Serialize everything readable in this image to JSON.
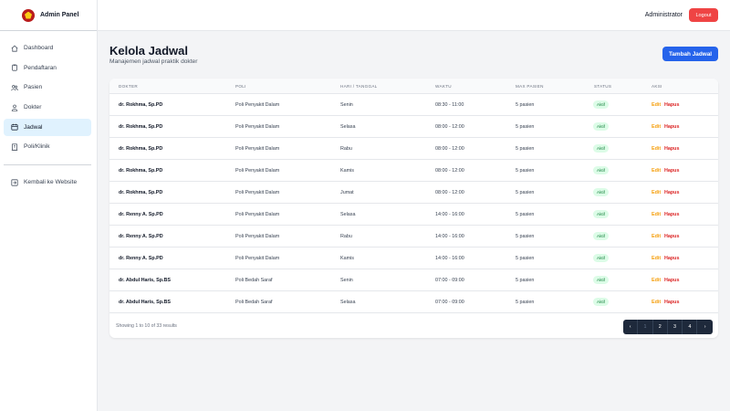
{
  "brand": {
    "title": "Admin Panel"
  },
  "sidebar": {
    "items": [
      {
        "label": "Dashboard",
        "icon": "home-icon"
      },
      {
        "label": "Pendaftaran",
        "icon": "clipboard-icon"
      },
      {
        "label": "Pasien",
        "icon": "users-icon"
      },
      {
        "label": "Dokter",
        "icon": "doctor-icon"
      },
      {
        "label": "Jadwal",
        "icon": "calendar-icon",
        "active": true
      },
      {
        "label": "Poli/Klinik",
        "icon": "building-icon"
      }
    ],
    "back_label": "Kembali ke Website"
  },
  "topbar": {
    "user": "Administrator",
    "logout": "Logout"
  },
  "header": {
    "title": "Kelola Jadwal",
    "subtitle": "Manajemen jadwal praktik dokter",
    "add_button": "Tambah Jadwal"
  },
  "table": {
    "columns": [
      "Dokter",
      "Poli",
      "Hari / Tanggal",
      "Waktu",
      "Max Pasien",
      "Status",
      "Aksi"
    ],
    "rows": [
      {
        "dokter": "dr. Rokhma, Sp.PD",
        "poli": "Poli Penyakit Dalam",
        "hari": "Senin",
        "waktu": "08:30 - 11:00",
        "max": "5 pasien",
        "status": "Aktif"
      },
      {
        "dokter": "dr. Rokhma, Sp.PD",
        "poli": "Poli Penyakit Dalam",
        "hari": "Selasa",
        "waktu": "08:00 - 12:00",
        "max": "5 pasien",
        "status": "Aktif"
      },
      {
        "dokter": "dr. Rokhma, Sp.PD",
        "poli": "Poli Penyakit Dalam",
        "hari": "Rabu",
        "waktu": "08:00 - 12:00",
        "max": "5 pasien",
        "status": "Aktif"
      },
      {
        "dokter": "dr. Rokhma, Sp.PD",
        "poli": "Poli Penyakit Dalam",
        "hari": "Kamis",
        "waktu": "08:00 - 12:00",
        "max": "5 pasien",
        "status": "Aktif"
      },
      {
        "dokter": "dr. Rokhma, Sp.PD",
        "poli": "Poli Penyakit Dalam",
        "hari": "Jumat",
        "waktu": "08:00 - 12:00",
        "max": "5 pasien",
        "status": "Aktif"
      },
      {
        "dokter": "dr. Renny A. Sp.PD",
        "poli": "Poli Penyakit Dalam",
        "hari": "Selasa",
        "waktu": "14:00 - 16:00",
        "max": "5 pasien",
        "status": "Aktif"
      },
      {
        "dokter": "dr. Renny A. Sp.PD",
        "poli": "Poli Penyakit Dalam",
        "hari": "Rabu",
        "waktu": "14:00 - 16:00",
        "max": "5 pasien",
        "status": "Aktif"
      },
      {
        "dokter": "dr. Renny A. Sp.PD",
        "poli": "Poli Penyakit Dalam",
        "hari": "Kamis",
        "waktu": "14:00 - 16:00",
        "max": "5 pasien",
        "status": "Aktif"
      },
      {
        "dokter": "dr. Abdul Haris, Sp.BS",
        "poli": "Poli Bedah Saraf",
        "hari": "Senin",
        "waktu": "07:00 - 09:00",
        "max": "5 pasien",
        "status": "Aktif"
      },
      {
        "dokter": "dr. Abdul Haris, Sp.BS",
        "poli": "Poli Bedah Saraf",
        "hari": "Selasa",
        "waktu": "07:00 - 09:00",
        "max": "5 pasien",
        "status": "Aktif"
      }
    ],
    "edit_label": "Edit",
    "delete_label": "Hapus"
  },
  "pagination": {
    "summary": "Showing 1 to 10 of 33 results",
    "pages": [
      "‹",
      "1",
      "2",
      "3",
      "4",
      "›"
    ]
  },
  "colors": {
    "primary": "#2563eb",
    "danger": "#ef4444",
    "active_nav": "#e0f2fe",
    "badge_bg": "#dcfce7",
    "badge_text": "#15803d",
    "edit": "#f59e0b",
    "pager": "#1e293b"
  }
}
